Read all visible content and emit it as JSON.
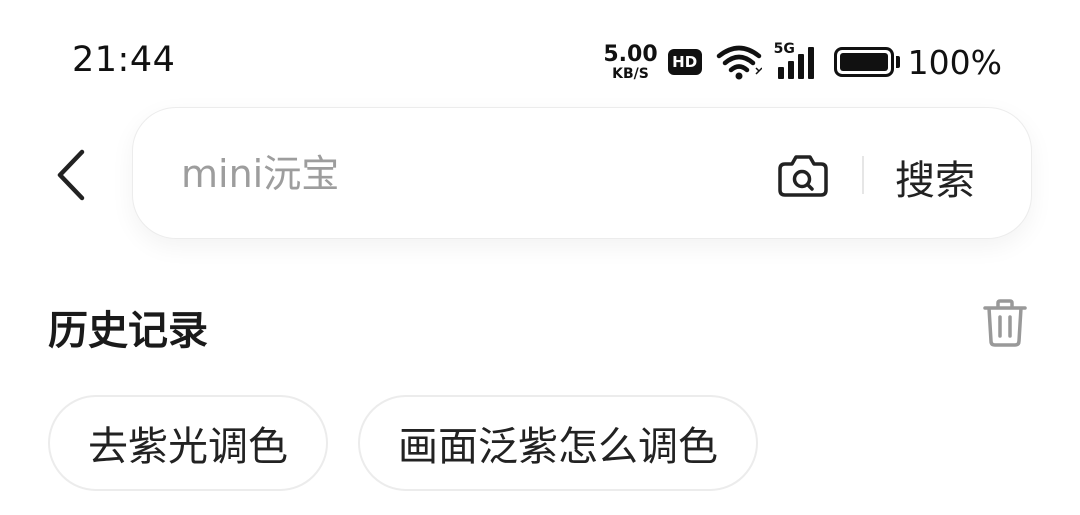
{
  "status_bar": {
    "time": "21:44",
    "net_speed_value": "5.00",
    "net_speed_unit": "KB/S",
    "hd_badge": "HD",
    "signal_label": "5G",
    "battery_percent": "100%",
    "battery_level": 1.0,
    "icons": [
      "wifi-icon",
      "cellular-signal-icon",
      "battery-icon"
    ]
  },
  "search": {
    "back_icon": "chevron-left-icon",
    "placeholder": "mini沅宝",
    "value": "",
    "camera_icon": "camera-search-icon",
    "search_label": "搜索"
  },
  "history": {
    "title": "历史记录",
    "clear_icon": "trash-icon",
    "items": [
      {
        "label": "去紫光调色"
      },
      {
        "label": "画面泛紫怎么调色"
      }
    ]
  },
  "colors": {
    "text": "#1a1a1a",
    "placeholder": "#9d9d9d",
    "border": "#ececec",
    "icon_gray": "#999999"
  }
}
